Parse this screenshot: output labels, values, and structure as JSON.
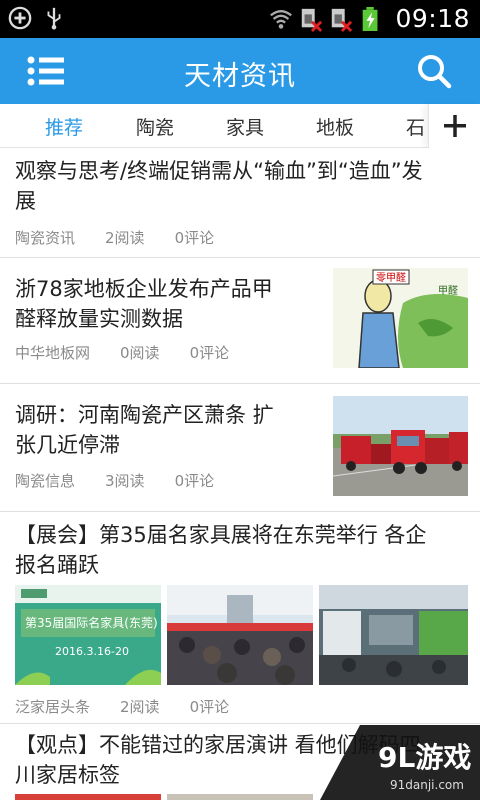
{
  "status_bar": {
    "time": "09:18"
  },
  "app_bar": {
    "title": "天材资讯"
  },
  "tabs": [
    {
      "label": "推荐"
    },
    {
      "label": "陶瓷"
    },
    {
      "label": "家具"
    },
    {
      "label": "地板"
    },
    {
      "label": "石"
    }
  ],
  "articles": [
    {
      "title_lines": [
        "观察与思考/终端促销需从“输血”到“造血”发",
        "展"
      ],
      "source": "陶瓷资讯",
      "reads": "2阅读",
      "comments": "0评论"
    },
    {
      "title_lines": [
        "浙78家地板企业发布产品甲",
        "醛释放量实测数据"
      ],
      "source": "中华地板网",
      "reads": "0阅读",
      "comments": "0评论",
      "thumb_labels": [
        "零甲醛",
        "甲醛"
      ]
    },
    {
      "title_lines": [
        "调研：河南陶瓷产区萧条 扩",
        "张几近停滞"
      ],
      "source": "陶瓷信息",
      "reads": "3阅读",
      "comments": "0评论"
    },
    {
      "title_lines": [
        "【展会】第35届名家具展将在东莞举行 各企",
        "报名踊跃"
      ],
      "source": "泛家居头条",
      "reads": "2阅读",
      "comments": "0评论",
      "expo_text": [
        "第35届国际名家具(东莞)",
        "2016.3.16-20"
      ]
    },
    {
      "title_lines": [
        "【观点】不能错过的家居演讲 看他们解码四",
        "川家居标签"
      ]
    }
  ],
  "watermark": {
    "logo": "9L游戏",
    "url": "91danji.com"
  }
}
